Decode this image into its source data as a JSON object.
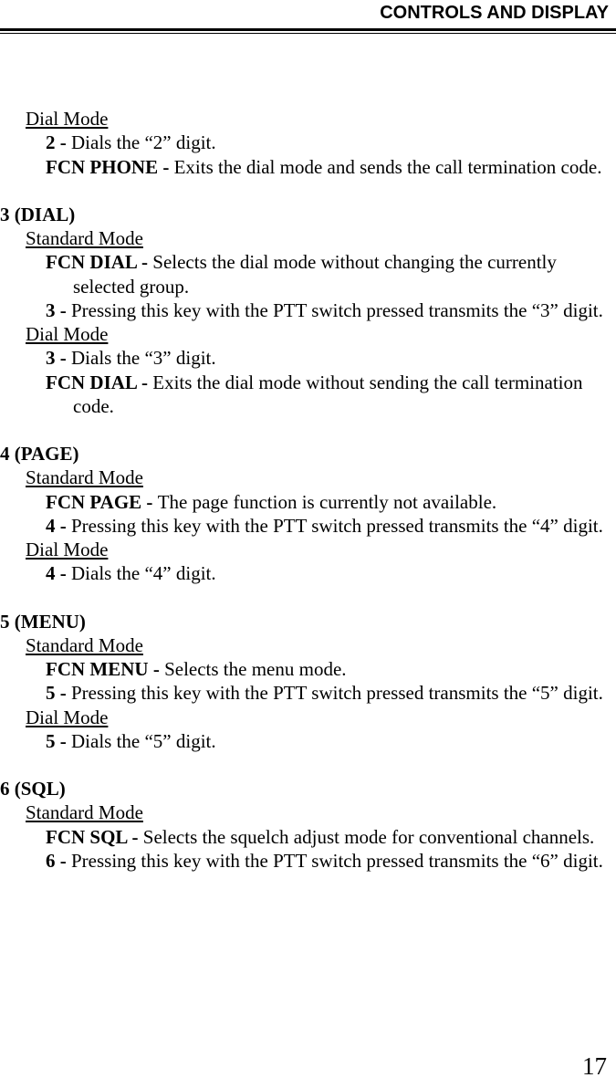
{
  "header": {
    "title": "CONTROLS AND DISPLAY"
  },
  "top": {
    "dialMode_label": "Dial Mode",
    "entries": [
      {
        "k": "2 - ",
        "t": "Dials the “2” digit."
      },
      {
        "k": "FCN PHONE - ",
        "t": "Exits the dial mode and sends the call termination code."
      }
    ]
  },
  "keys": [
    {
      "heading": "3 (DIAL)",
      "standard_label": "Standard Mode",
      "standard_entries": [
        {
          "k": "FCN DIAL - ",
          "t": "Selects the dial mode without changing the currently selected group."
        },
        {
          "k": "3 - ",
          "t": "Pressing this key with the PTT switch pressed transmits the “3” digit."
        }
      ],
      "dial_label": "Dial Mode",
      "dial_entries": [
        {
          "k": "3 - ",
          "t": "Dials the “3” digit."
        },
        {
          "k": "FCN DIAL - ",
          "t": "Exits the dial mode without sending the call termination code."
        }
      ]
    },
    {
      "heading": "4 (PAGE)",
      "standard_label": "Standard Mode",
      "standard_entries": [
        {
          "k": "FCN PAGE - ",
          "t": "The page function is currently not available."
        },
        {
          "k": "4 - ",
          "t": "Pressing this key with the PTT switch pressed transmits the “4” digit."
        }
      ],
      "dial_label": "Dial Mode",
      "dial_entries": [
        {
          "k": "4 - ",
          "t": "Dials the “4” digit."
        }
      ]
    },
    {
      "heading": "5 (MENU)",
      "standard_label": "Standard Mode",
      "standard_entries": [
        {
          "k": "FCN MENU - ",
          "t": "Selects the menu mode."
        },
        {
          "k": "5 - ",
          "t": "Pressing this key with the PTT switch pressed transmits the “5” digit."
        }
      ],
      "dial_label": "Dial Mode",
      "dial_entries": [
        {
          "k": "5 - ",
          "t": "Dials the “5” digit."
        }
      ]
    },
    {
      "heading": "6 (SQL)",
      "standard_label": "Standard Mode",
      "standard_entries": [
        {
          "k": "FCN SQL - ",
          "t": "Selects the squelch adjust mode for conventional channels."
        },
        {
          "k": "6 - ",
          "t": "Pressing this key with the PTT switch pressed transmits the “6” digit."
        }
      ]
    }
  ],
  "footer": {
    "page_number": "17"
  }
}
